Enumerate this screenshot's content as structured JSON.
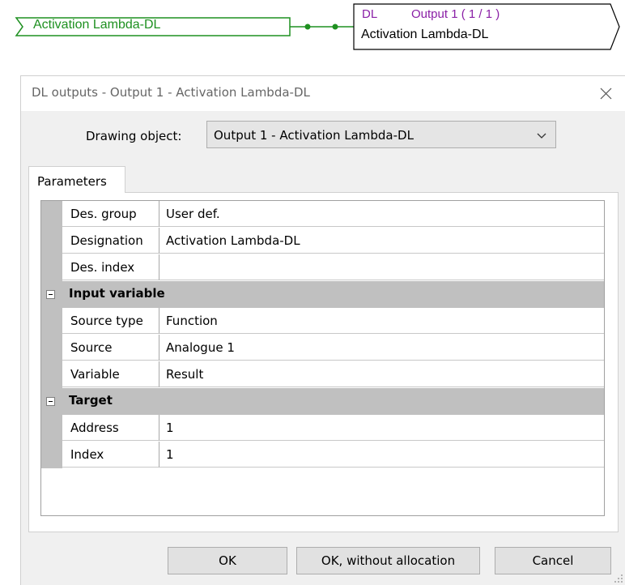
{
  "diagram": {
    "input_label": "Activation Lambda-DL",
    "output_tag": "DL",
    "output_title": "Output 1 ( 1 / 1 )",
    "output_label": "Activation Lambda-DL",
    "colors": {
      "input": "#1e9020",
      "output_title": "#8a1fa6",
      "wire": "#1e9020"
    }
  },
  "dialog": {
    "title": "DL outputs - Output 1 - Activation Lambda-DL",
    "close_icon": "close-icon",
    "drawing_object": {
      "label": "Drawing object:",
      "value": "Output 1 - Activation Lambda-DL"
    },
    "tabs": [
      {
        "label": "Parameters"
      }
    ],
    "properties": [
      {
        "key": "Des. group",
        "value": "User def."
      },
      {
        "key": "Designation",
        "value": "Activation Lambda-DL"
      },
      {
        "key": "Des. index",
        "value": ""
      }
    ],
    "input_variable": {
      "title": "Input variable",
      "rows": [
        {
          "key": "Source type",
          "value": "Function"
        },
        {
          "key": "Source",
          "value": "Analogue 1"
        },
        {
          "key": "Variable",
          "value": "Result"
        }
      ]
    },
    "target": {
      "title": "Target",
      "rows": [
        {
          "key": "Address",
          "value": "1"
        },
        {
          "key": "Index",
          "value": "1"
        }
      ]
    },
    "buttons": {
      "ok": "OK",
      "ok_without_allocation": "OK, without allocation",
      "cancel": "Cancel"
    }
  }
}
